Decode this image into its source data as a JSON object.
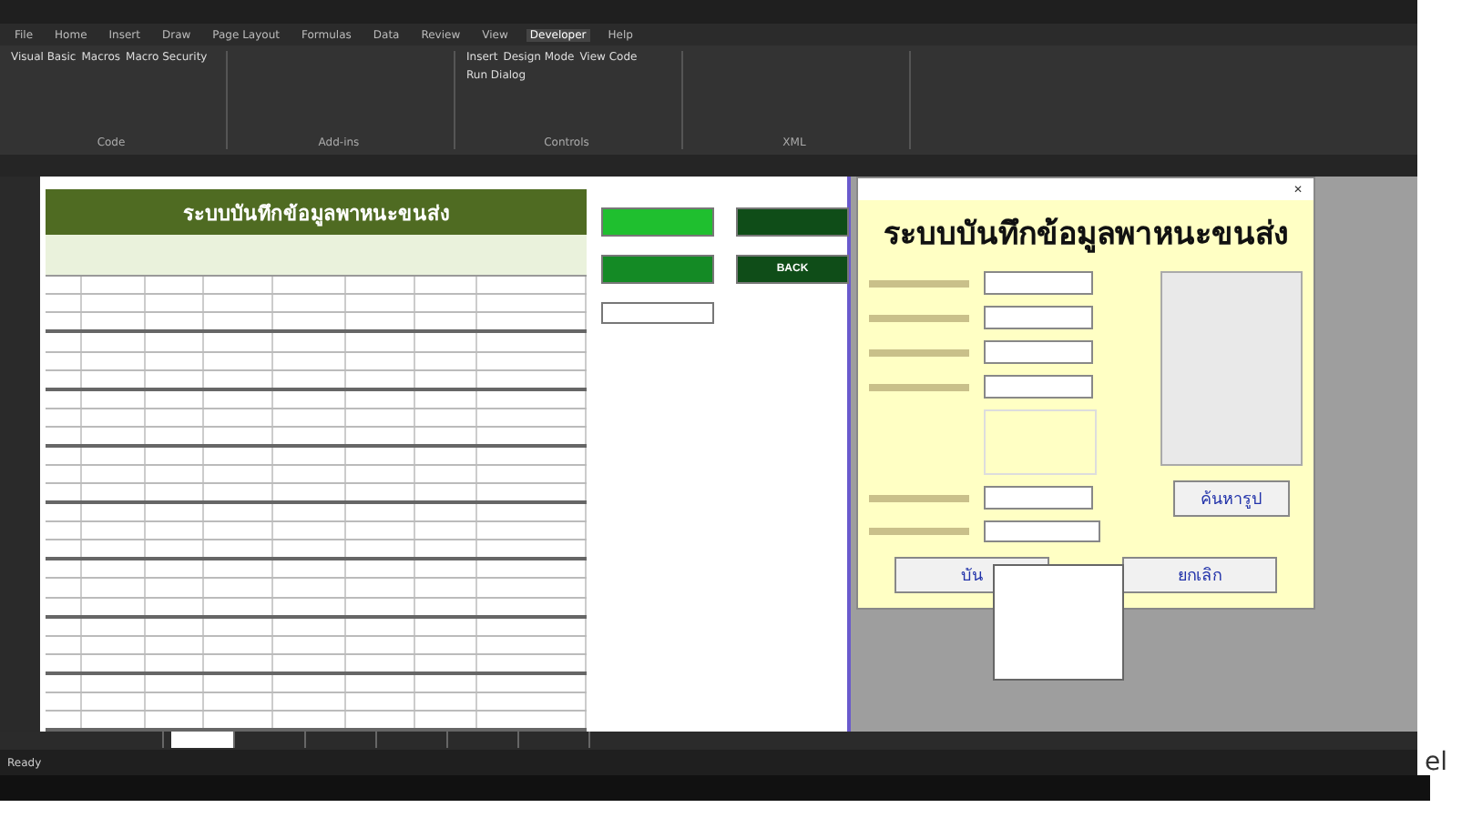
{
  "ribbon_tabs": [
    {
      "label": "File",
      "selected": false
    },
    {
      "label": "Home",
      "selected": false
    },
    {
      "label": "Insert",
      "selected": false
    },
    {
      "label": "Draw",
      "selected": false
    },
    {
      "label": "Page Layout",
      "selected": false
    },
    {
      "label": "Formulas",
      "selected": false
    },
    {
      "label": "Data",
      "selected": false
    },
    {
      "label": "Review",
      "selected": false
    },
    {
      "label": "View",
      "selected": false
    },
    {
      "label": "Developer",
      "selected": true
    },
    {
      "label": "Help",
      "selected": false
    }
  ],
  "ribbon_groups": [
    {
      "label": "Code",
      "buttons": [
        "Visual Basic",
        "Macros",
        "Macro Security"
      ]
    },
    {
      "label": "Add-ins"
    },
    {
      "label": "Controls",
      "buttons": [
        "Insert",
        "Design Mode",
        "View Code",
        "Run Dialog"
      ]
    },
    {
      "label": "XML"
    }
  ],
  "sheet": {
    "title": "ระบบบันทึกข้อมูลพาหนะขนส่ง",
    "buttons": [
      {
        "kind": "bright"
      },
      {
        "kind": "dark"
      },
      {
        "kind": "medium"
      },
      {
        "kind": "dark",
        "label": "BACK"
      },
      {
        "kind": "outline"
      }
    ]
  },
  "sheet_tabs": [
    {
      "selected": false
    },
    {
      "selected": true
    },
    {
      "selected": false
    },
    {
      "selected": false
    },
    {
      "selected": false
    },
    {
      "selected": false
    },
    {
      "selected": false
    }
  ],
  "status_bar": {
    "text": "Ready"
  },
  "form": {
    "close_glyph": "✕",
    "title": "ระบบบันทึกข้อมูลพาหนะขนส่ง",
    "search_image_button": "ค้นหารูป",
    "save_button": "บัน",
    "cancel_button": "ยกเลิก",
    "dropdown_expanded": true
  },
  "corner_text": "el"
}
